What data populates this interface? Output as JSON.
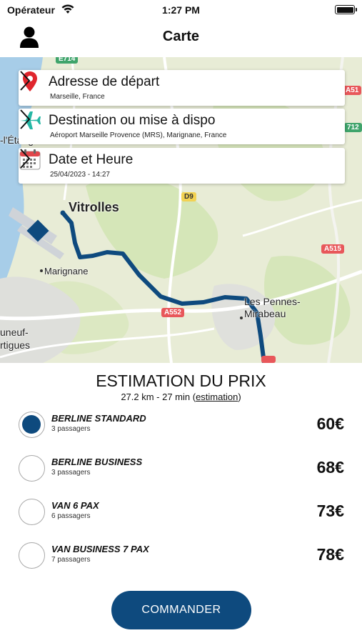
{
  "status_bar": {
    "carrier": "Opérateur",
    "time": "1:27 PM"
  },
  "nav": {
    "title": "Carte",
    "user_icon": "user-icon"
  },
  "map": {
    "labels": {
      "vitrolles": "Vitrolles",
      "marignane": "Marignane",
      "les_pennes_1": "Les Pennes-",
      "les_pennes_2": "Mirabeau",
      "etang": "-l'Étang",
      "neuf_1": "uneuf-",
      "neuf_2": "rtigues"
    },
    "roads": {
      "e714": "E714",
      "a51": "A51",
      "r712": "712",
      "d9": "D9",
      "a515": "A515",
      "a552": "A552"
    },
    "route_color": "#0e4a7e"
  },
  "cards": {
    "departure": {
      "title": "Adresse de départ",
      "subtitle": "Marseille, France",
      "icon": "location-pin-icon"
    },
    "destination": {
      "title": "Destination ou mise à dispo",
      "subtitle": "Aéroport Marseille Provence (MRS), Marignane, France",
      "icon": "airplane-icon"
    },
    "datetime": {
      "title": "Date et Heure",
      "subtitle": "25/04/2023 - 14:27",
      "icon": "calendar-icon"
    }
  },
  "estimation": {
    "title": "ESTIMATION DU PRIX",
    "summary": "27.2 km - 27 min (",
    "link": "estimation",
    "summary_end": ")"
  },
  "options": [
    {
      "name": "BERLINE STANDARD",
      "pax": "3 passagers",
      "price": "60€",
      "selected": true
    },
    {
      "name": "BERLINE BUSINESS",
      "pax": "3 passagers",
      "price": "68€",
      "selected": false
    },
    {
      "name": "VAN 6 PAX",
      "pax": "6 passagers",
      "price": "73€",
      "selected": false
    },
    {
      "name": "VAN BUSINESS 7 PAX",
      "pax": "7 passagers",
      "price": "78€",
      "selected": false
    }
  ],
  "order_button": {
    "label": "COMMANDER"
  },
  "colors": {
    "accent": "#0e4a7e",
    "map_land": "#e8ecd6",
    "map_water": "#a7cde8"
  }
}
